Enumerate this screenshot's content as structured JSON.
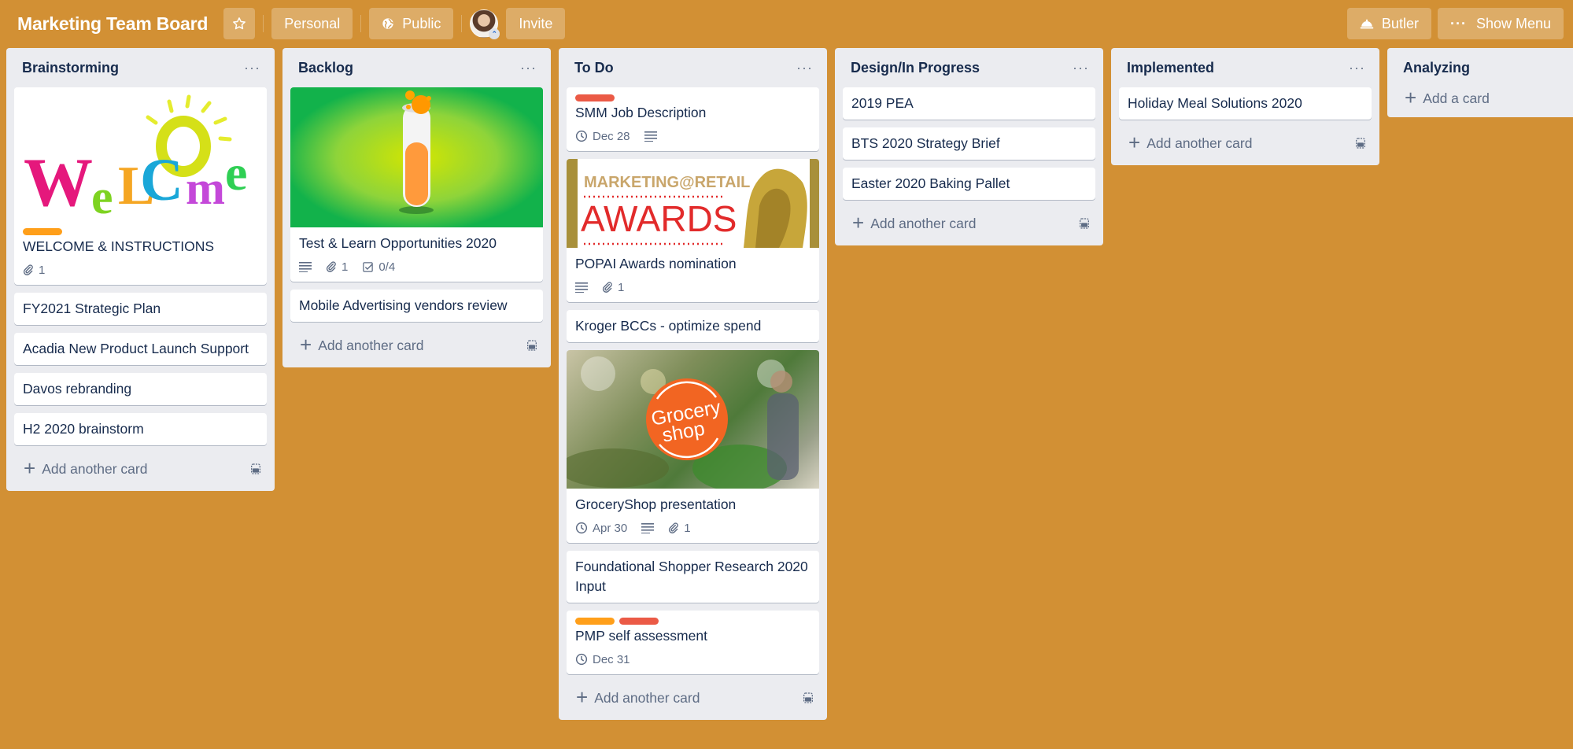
{
  "header": {
    "board_title": "Marketing Team Board",
    "star_icon": "star-icon",
    "personal_label": "Personal",
    "public_label": "Public",
    "invite_label": "Invite",
    "butler_label": "Butler",
    "show_menu_label": "Show Menu"
  },
  "colors": {
    "board_background": "#d29034",
    "label_orange": "#ff9f1a",
    "label_red": "#eb5a46",
    "list_background": "#ebecf0"
  },
  "common": {
    "add_another_card": "Add another card",
    "add_a_card": "Add a card",
    "list_menu": "···"
  },
  "lists": [
    {
      "title": "Brainstorming",
      "cards": [
        {
          "cover": "welcome-image",
          "labels": [
            "orange"
          ],
          "title": "WELCOME & INSTRUCTIONS",
          "attachments": "1"
        },
        {
          "title": "FY2021 Strategic Plan"
        },
        {
          "title": "Acadia New Product Launch Support"
        },
        {
          "title": "Davos rebranding"
        },
        {
          "title": "H2 2020 brainstorm"
        }
      ]
    },
    {
      "title": "Backlog",
      "cards": [
        {
          "cover": "test-tube-image",
          "title": "Test & Learn Opportunities 2020",
          "has_description": true,
          "attachments": "1",
          "checklist": "0/4"
        },
        {
          "title": "Mobile Advertising vendors review"
        }
      ]
    },
    {
      "title": "To Do",
      "cards": [
        {
          "labels": [
            "red"
          ],
          "title": "SMM Job Description",
          "due": "Dec 28",
          "has_description": true
        },
        {
          "cover": "awards-image",
          "cover_text_top": "MARKETING@RETAIL",
          "cover_text_main": "AWARDS",
          "title": "POPAI Awards nomination",
          "has_description": true,
          "attachments": "1"
        },
        {
          "title": "Kroger BCCs - optimize spend"
        },
        {
          "cover": "groceryshop-image",
          "cover_text_top": "Grocery",
          "cover_text_main": "shop",
          "title": "GroceryShop presentation",
          "due": "Apr 30",
          "has_description": true,
          "attachments": "1"
        },
        {
          "title": "Foundational Shopper Research 2020 Input"
        },
        {
          "labels": [
            "orange",
            "red"
          ],
          "title": "PMP self assessment",
          "due": "Dec 31"
        }
      ]
    },
    {
      "title": "Design/In Progress",
      "cards": [
        {
          "title": "2019 PEA"
        },
        {
          "title": "BTS 2020 Strategy Brief"
        },
        {
          "title": "Easter 2020 Baking Pallet"
        }
      ]
    },
    {
      "title": "Implemented",
      "cards": [
        {
          "title": "Holiday Meal Solutions 2020"
        }
      ]
    },
    {
      "title": "Analyzing",
      "cards": []
    }
  ]
}
